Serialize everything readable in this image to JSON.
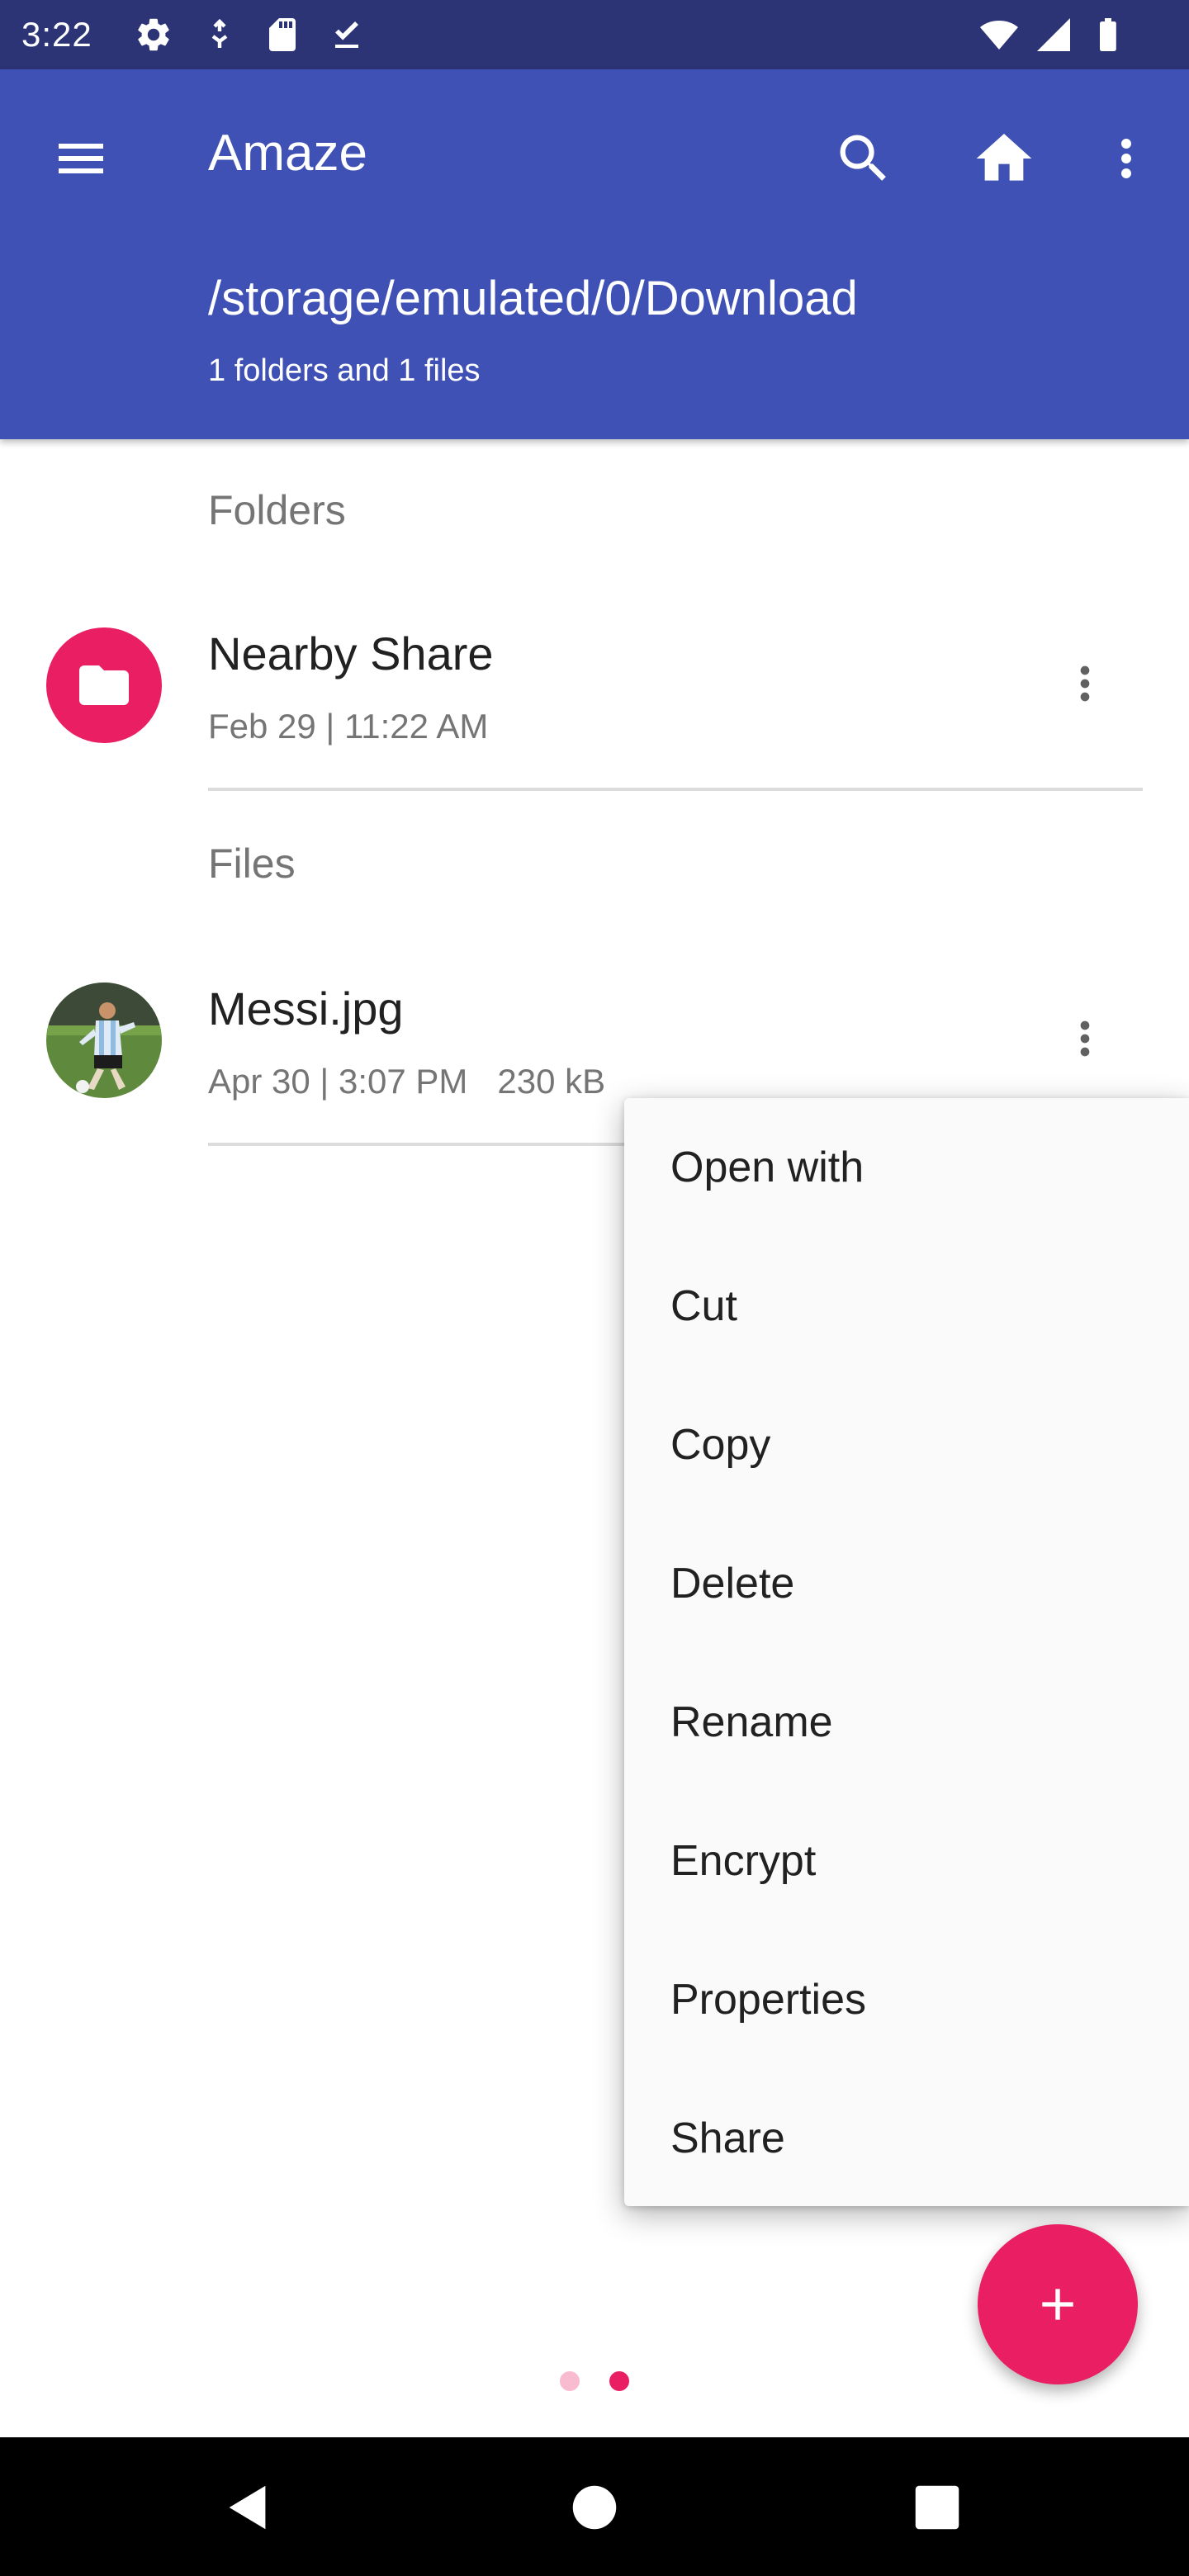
{
  "status_bar": {
    "time": "3:22",
    "icons": [
      "gear-icon",
      "usb-debug-icon",
      "sd-card-icon",
      "download-done-icon",
      "wifi-icon",
      "signal-icon",
      "battery-icon"
    ]
  },
  "app_bar": {
    "title": "Amaze",
    "path": "/storage/emulated/0/Download",
    "summary": "1 folders and 1 files",
    "icons": [
      "menu-icon",
      "search-icon",
      "home-icon",
      "more-vert-icon"
    ]
  },
  "sections": {
    "folders_header": "Folders",
    "files_header": "Files"
  },
  "folders": [
    {
      "name": "Nearby Share",
      "date": "Feb 29 | 11:22 AM",
      "icon": "folder-icon",
      "icon_bg": "#e91e63"
    }
  ],
  "files": [
    {
      "name": "Messi.jpg",
      "date": "Apr 30 | 3:07 PM",
      "size": "230 kB",
      "icon": "image-thumbnail"
    }
  ],
  "context_menu": {
    "items": [
      "Open with",
      "Cut",
      "Copy",
      "Delete",
      "Rename",
      "Encrypt",
      "Properties",
      "Share"
    ]
  },
  "page_indicator": {
    "count": 2,
    "active_index": 1
  },
  "fab": {
    "icon": "plus-icon",
    "color": "#e91e63"
  },
  "nav_bar": {
    "icons": [
      "back-icon",
      "home-circle-icon",
      "recents-icon"
    ]
  },
  "colors": {
    "primary": "#3f51b5",
    "status_bar": "#2c3476",
    "accent": "#e91e63"
  }
}
